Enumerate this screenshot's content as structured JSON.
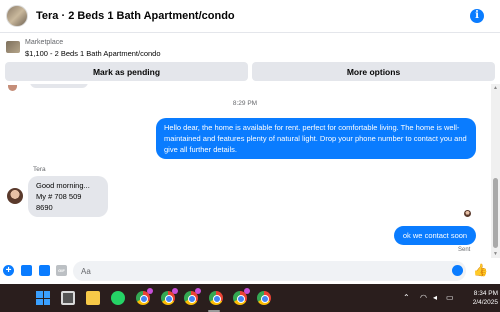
{
  "header": {
    "title": "Tera · 2 Beds 1 Bath Apartment/condo"
  },
  "marketplace": {
    "label": "Marketplace",
    "listing": "$1,100 - 2 Beds 1 Bath Apartment/condo",
    "buttons": {
      "mark_pending": "Mark as pending",
      "more_options": "More options"
    }
  },
  "chat": {
    "timestamp": "8:29 PM",
    "messages": [
      {
        "direction": "outgoing",
        "text": "Hello dear,  the home is available for rent. perfect for comfortable living. The home is well-maintained and features plenty of natural light. Drop your phone number to contact you and give all further details."
      },
      {
        "direction": "incoming",
        "sender": "Tera",
        "lines": [
          "Good morning...",
          "My # 708 509 8690"
        ]
      },
      {
        "direction": "outgoing",
        "text": "ok we contact soon"
      }
    ],
    "status": "Sent"
  },
  "composer": {
    "placeholder": "Aa"
  },
  "taskbar": {
    "time": "8:34 PM",
    "date": "2/4/2025"
  },
  "colors": {
    "accent": "#0a7cff",
    "bubble_incoming": "#e4e6eb",
    "taskbar_bg": "#2a1e1d"
  }
}
